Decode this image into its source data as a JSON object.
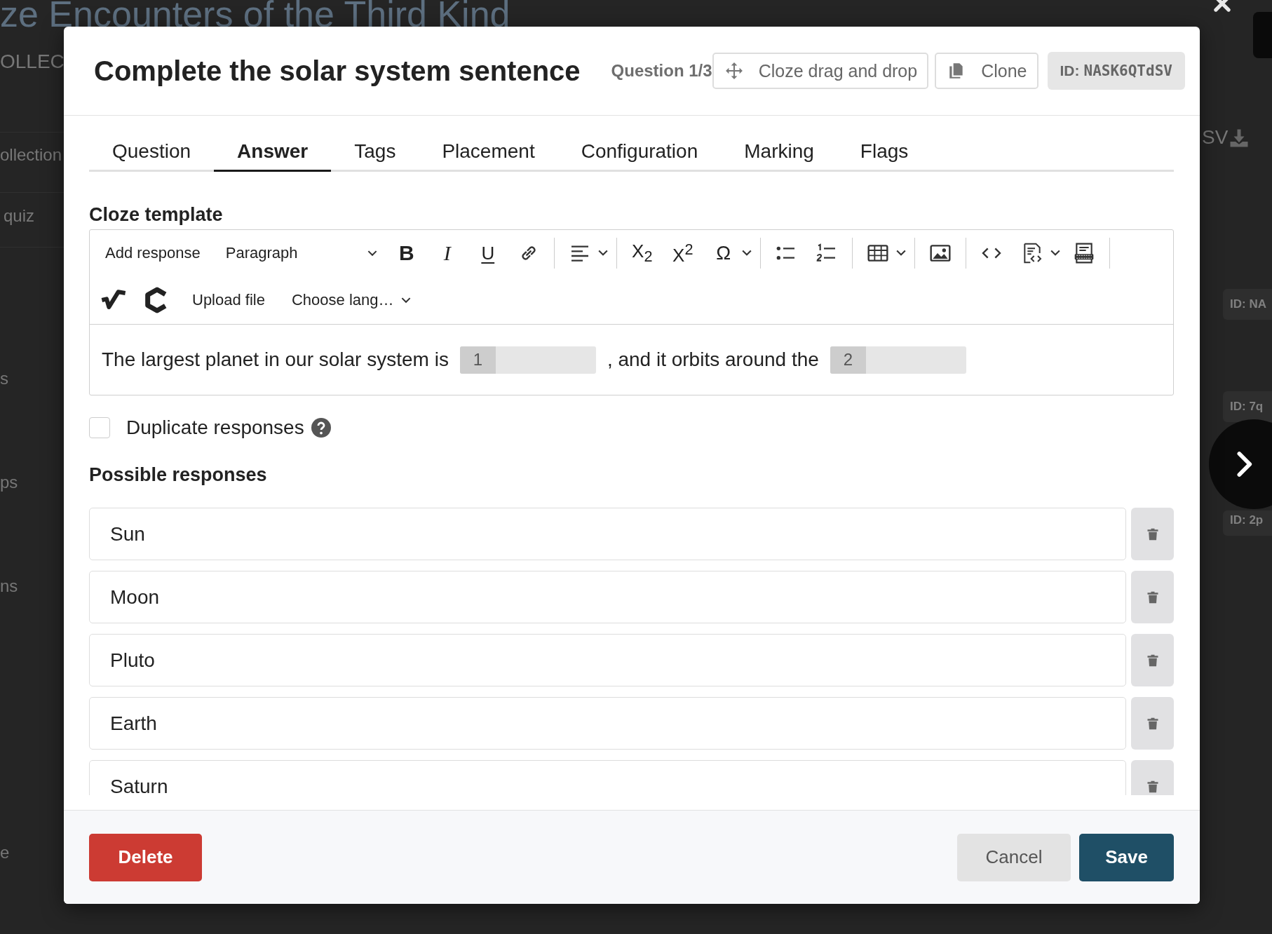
{
  "background": {
    "heading": "ze Encounters of the Third Kind",
    "subheading": "OLLEC",
    "side_items": [
      "ollection",
      "quiz",
      "s",
      "ps",
      "ns",
      "e"
    ],
    "export_label": "SV",
    "id_badges": [
      "ID: NA",
      "ID: 7q",
      "ID: 2p"
    ]
  },
  "modal": {
    "title": "Complete the solar system sentence",
    "counter": "Question 1/3",
    "type_button": "Cloze drag and drop",
    "clone_button": "Clone",
    "id_label": "ID:",
    "id_value": "NASK6QTdSV"
  },
  "tabs": [
    {
      "label": "Question",
      "selected": false
    },
    {
      "label": "Answer",
      "selected": true
    },
    {
      "label": "Tags",
      "selected": false
    },
    {
      "label": "Placement",
      "selected": false
    },
    {
      "label": "Configuration",
      "selected": false
    },
    {
      "label": "Marking",
      "selected": false
    },
    {
      "label": "Flags",
      "selected": false
    }
  ],
  "template": {
    "heading": "Cloze template",
    "toolbar": {
      "add_response": "Add response",
      "block_format": "Paragraph",
      "bold": "B",
      "italic": "I",
      "underline": "U",
      "subscript": "X$_{2}$",
      "superscript": "X$^{2}$",
      "special_char": "Ω",
      "upload": "Upload file",
      "language": "Choose lang…"
    },
    "content": [
      {
        "kind": "text",
        "text": "The largest planet in our solar system is"
      },
      {
        "kind": "slot",
        "text": "1"
      },
      {
        "kind": "text",
        "text": ", and it orbits around the"
      },
      {
        "kind": "slot",
        "text": "2"
      }
    ]
  },
  "duplicate_responses": {
    "label": "Duplicate responses",
    "checked": false
  },
  "responses": {
    "heading": "Possible responses",
    "items": [
      "Sun",
      "Moon",
      "Pluto",
      "Earth",
      "Saturn"
    ]
  },
  "footer": {
    "delete": "Delete",
    "cancel": "Cancel",
    "save": "Save"
  }
}
